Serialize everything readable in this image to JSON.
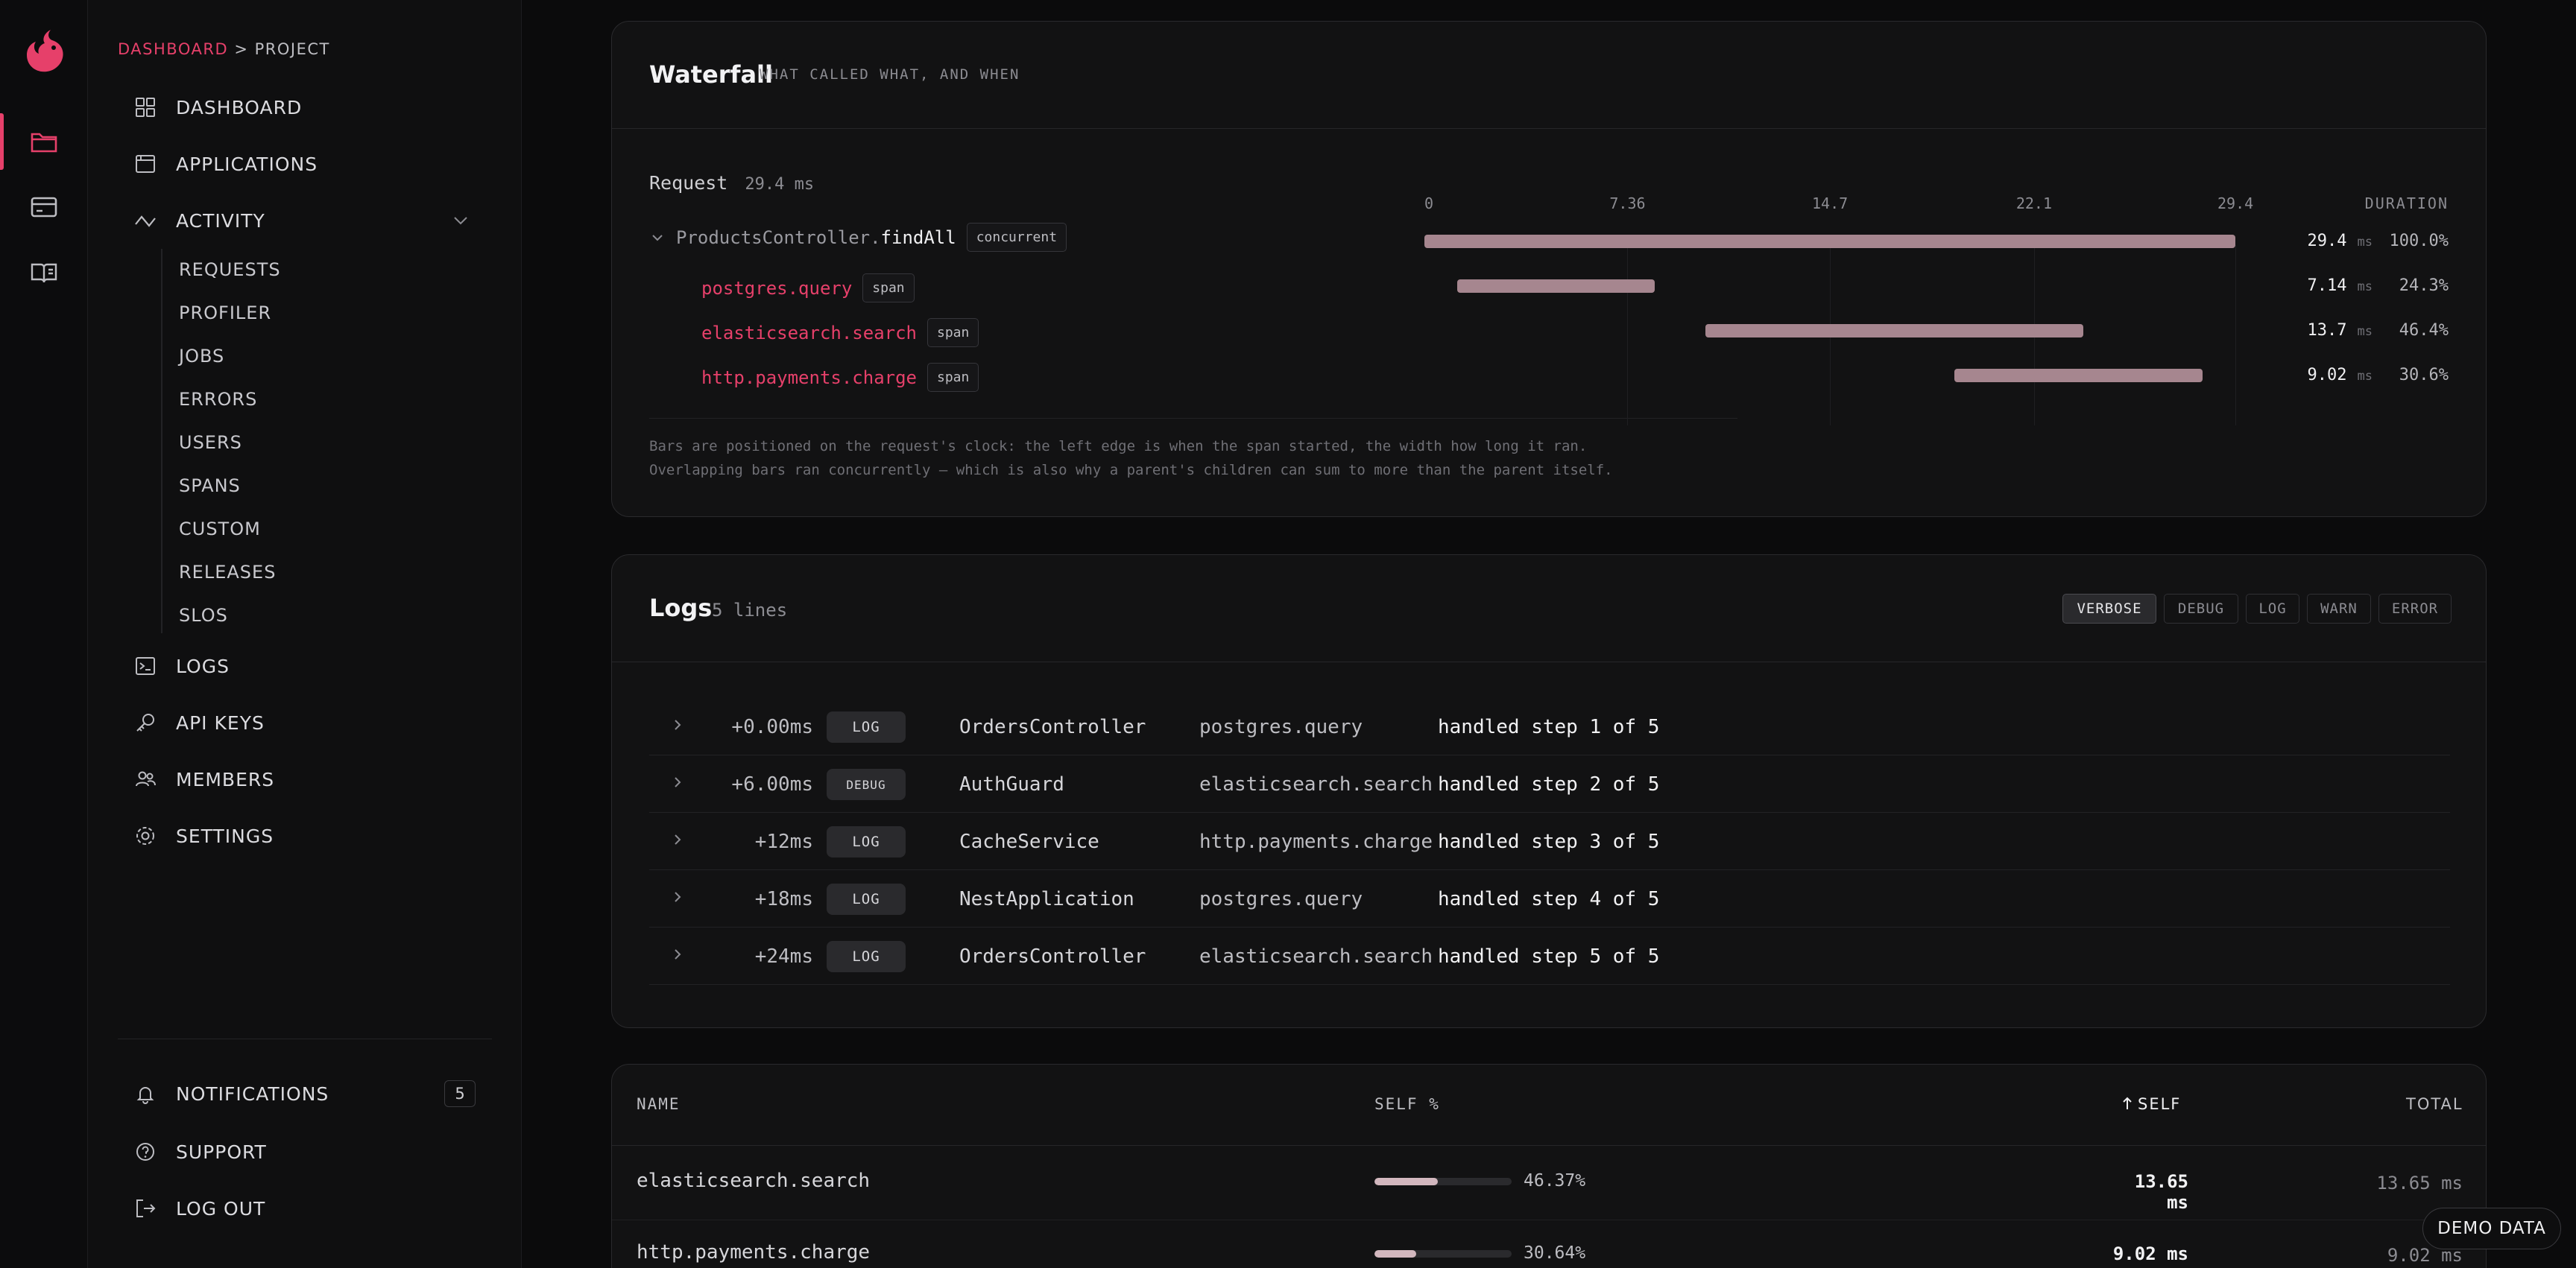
{
  "breadcrumb": {
    "root": "DASHBOARD",
    "sep": ">",
    "current": "PROJECT"
  },
  "nav": {
    "dashboard": "DASHBOARD",
    "applications": "APPLICATIONS",
    "activity": "ACTIVITY",
    "activity_sub": [
      "REQUESTS",
      "PROFILER",
      "JOBS",
      "ERRORS",
      "USERS",
      "SPANS",
      "CUSTOM",
      "RELEASES",
      "SLOS"
    ],
    "logs": "LOGS",
    "api_keys": "API KEYS",
    "members": "MEMBERS",
    "settings": "SETTINGS",
    "notifications": "NOTIFICATIONS",
    "notifications_count": "5",
    "support": "SUPPORT",
    "logout": "LOG OUT"
  },
  "waterfall": {
    "title": "Waterfall",
    "subtitle": "WHAT CALLED WHAT, AND WHEN",
    "request_label": "Request",
    "request_ms": "29.4 ms",
    "ticks": [
      "0",
      "7.36",
      "14.7",
      "22.1",
      "29.4"
    ],
    "duration_header": "DURATION",
    "root": {
      "prefix": "ProductsController.",
      "method": "findAll",
      "tag": "concurrent",
      "start": 0,
      "dur": 29.4,
      "dur_label": "29.4",
      "unit": "ms",
      "pct": "100.0%"
    },
    "spans": [
      {
        "name": "postgres.query",
        "tag": "span",
        "start": 1.2,
        "dur": 7.14,
        "dur_label": "7.14",
        "unit": "ms",
        "pct": "24.3%"
      },
      {
        "name": "elasticsearch.search",
        "tag": "span",
        "start": 10.2,
        "dur": 13.7,
        "dur_label": "13.7",
        "unit": "ms",
        "pct": "46.4%"
      },
      {
        "name": "http.payments.charge",
        "tag": "span",
        "start": 19.2,
        "dur": 9.02,
        "dur_label": "9.02",
        "unit": "ms",
        "pct": "30.6%"
      }
    ],
    "note_1": "Bars are positioned on the request's clock: the left edge is when the span started, the width how long it ran.",
    "note_2": "Overlapping bars ran concurrently — which is also why a parent's children can sum to more than the parent itself."
  },
  "logs": {
    "title": "Logs",
    "count": "5 lines",
    "filters": [
      "VERBOSE",
      "DEBUG",
      "LOG",
      "WARN",
      "ERROR"
    ],
    "rows": [
      {
        "offset": "+0.00ms",
        "level": "LOG",
        "context": "OrdersController",
        "span": "postgres.query",
        "message": "handled step 1 of 5"
      },
      {
        "offset": "+6.00ms",
        "level": "DEBUG",
        "context": "AuthGuard",
        "span": "elasticsearch.search",
        "message": "handled step 2 of 5"
      },
      {
        "offset": "+12ms",
        "level": "LOG",
        "context": "CacheService",
        "span": "http.payments.charge",
        "message": "handled step 3 of 5"
      },
      {
        "offset": "+18ms",
        "level": "LOG",
        "context": "NestApplication",
        "span": "postgres.query",
        "message": "handled step 4 of 5"
      },
      {
        "offset": "+24ms",
        "level": "LOG",
        "context": "OrdersController",
        "span": "elasticsearch.search",
        "message": "handled step 5 of 5"
      }
    ]
  },
  "profile_table": {
    "headers": {
      "name": "NAME",
      "self_pct": "SELF %",
      "self": "SELF",
      "total": "TOTAL"
    },
    "rows": [
      {
        "name": "elasticsearch.search",
        "self_pct": "46.37%",
        "self_frac": 0.4637,
        "self": "13.65 ms",
        "total": "13.65 ms"
      },
      {
        "name": "http.payments.charge",
        "self_pct": "30.64%",
        "self_frac": 0.3064,
        "self": "9.02 ms",
        "total": "9.02 ms"
      }
    ]
  },
  "demo_badge": "DEMO DATA",
  "colors": {
    "accent": "#e6406a",
    "bar": "#a6868f"
  }
}
